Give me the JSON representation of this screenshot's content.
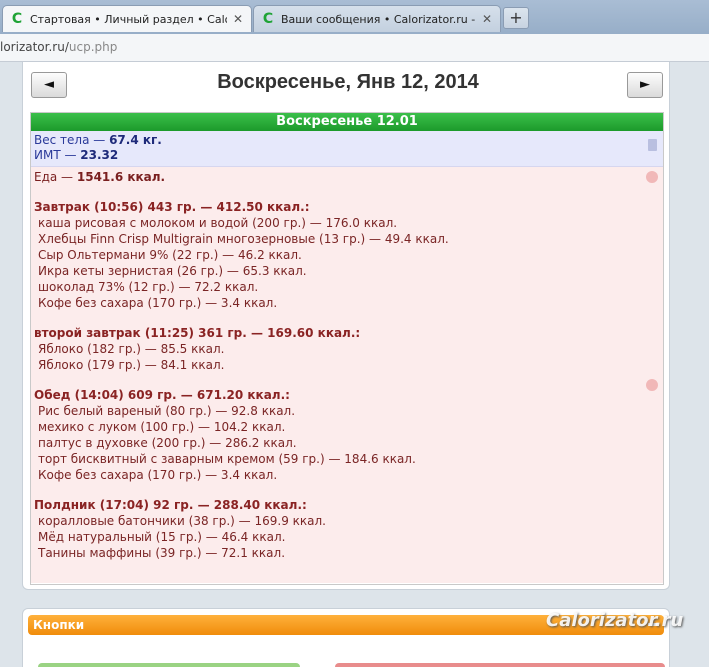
{
  "browser": {
    "tabs": [
      {
        "title": "Стартовая • Личный раздел • Calori...",
        "active": true,
        "close": "✕"
      },
      {
        "title": "Ваши сообщения • Calorizator.ru - ...",
        "active": false,
        "close": "✕"
      }
    ],
    "new_tab": "+",
    "favicon": "C",
    "url_host": "lorizator.ru/",
    "url_path": "ucp.php"
  },
  "nav": {
    "prev": "◄",
    "next": "►",
    "date_title": "Воскресенье, Янв 12, 2014"
  },
  "day": {
    "header": "Воскресенье 12.01",
    "weight_label": "Вес тела — ",
    "weight_value": "67.4 кг.",
    "bmi_label": "ИМТ — ",
    "bmi_value": "23.32",
    "food_label": "Еда — ",
    "food_value": "1541.6 ккал."
  },
  "meals": [
    {
      "title": "Завтрак (10:56) 443 гр. — 412.50 ккал.:",
      "items": [
        "каша рисовая с молоком и водой (200 гр.) — 176.0 ккал.",
        "Хлебцы Finn Crisp Multigrain многозерновые (13 гр.) — 49.4 ккал.",
        "Сыр Ольтермани 9% (22 гр.) — 46.2 ккал.",
        "Икра кеты зернистая (26 гр.) — 65.3 ккал.",
        "шоколад 73% (12 гр.) — 72.2 ккал.",
        "Кофе без сахара (170 гр.) — 3.4 ккал."
      ]
    },
    {
      "title": "второй завтрак (11:25) 361 гр. — 169.60 ккал.:",
      "items": [
        "Яблоко (182 гр.) — 85.5 ккал.",
        "Яблоко (179 гр.) — 84.1 ккал."
      ]
    },
    {
      "title": "Обед (14:04) 609 гр. — 671.20 ккал.:",
      "items": [
        "Рис белый вареный (80 гр.) — 92.8 ккал.",
        "мехико с луком (100 гр.) — 104.2 ккал.",
        "палтус в духовке (200 гр.) — 286.2 ккал.",
        "торт бисквитный с заварным кремом (59 гр.) — 184.6 ккал.",
        "Кофе без сахара (170 гр.) — 3.4 ккал."
      ]
    },
    {
      "title": "Полдник (17:04) 92 гр. — 288.40 ккал.:",
      "items": [
        "коралловые батончики (38 гр.) — 169.9 ккал.",
        "Мёд натуральный (15 гр.) — 46.4 ккал.",
        "Танины маффины (39 гр.) — 72.1 ккал."
      ]
    }
  ],
  "buttons_panel": {
    "title": "Кнопки"
  },
  "watermark": "Calorizator.ru"
}
